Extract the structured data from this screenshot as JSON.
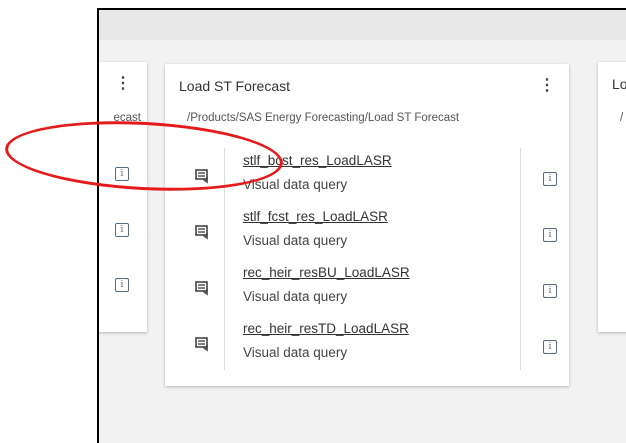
{
  "cards": {
    "left": {
      "path_fragment": "ecast"
    },
    "main": {
      "title": "Load ST Forecast",
      "path": "/Products/SAS Energy Forecasting/Load ST Forecast",
      "items": [
        {
          "name": "stlf_bcst_res_LoadLASR",
          "type": "Visual data query"
        },
        {
          "name": "stlf_fcst_res_LoadLASR",
          "type": "Visual data query"
        },
        {
          "name": "rec_heir_resBU_LoadLASR",
          "type": "Visual data query"
        },
        {
          "name": "rec_heir_resTD_LoadLASR",
          "type": "Visual data query"
        }
      ]
    },
    "right": {
      "title_fragment": "Lo",
      "path_fragment": "/"
    }
  },
  "icons": {
    "kebab": "⋮",
    "item": "data-query-icon",
    "info": "i"
  },
  "colors": {
    "annotation": "#e51b1b",
    "background": "#f2f2f2"
  }
}
